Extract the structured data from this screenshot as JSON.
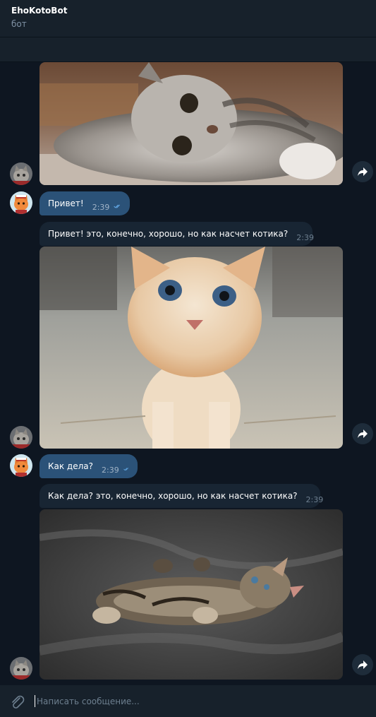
{
  "header": {
    "title": "EhoKotoBot",
    "subtitle": "бот"
  },
  "messages": [
    {
      "type": "photo",
      "from": "bot",
      "alt": "gray tabby kitten lying on a rug"
    },
    {
      "type": "text",
      "from": "user",
      "text": "Привет!",
      "time": "2:39",
      "status": "read"
    },
    {
      "type": "text",
      "from": "bot",
      "text": "Привет! это, конечно, хорошо, но как насчет котика?",
      "time": "2:39"
    },
    {
      "type": "photo",
      "from": "bot",
      "alt": "ginger kitten with blue eyes"
    },
    {
      "type": "text",
      "from": "user",
      "text": "Как дела?",
      "time": "2:39",
      "status": "read"
    },
    {
      "type": "text",
      "from": "bot",
      "text": "Как дела? это, конечно, хорошо, но как насчет котика?",
      "time": "2:39"
    },
    {
      "type": "photo",
      "from": "bot",
      "alt": "tabby kitten lying on its back"
    }
  ],
  "composer": {
    "placeholder": "Написать сообщение..."
  },
  "icons": {
    "forward": "forward-arrow-icon",
    "attach": "paperclip-icon",
    "read": "double-check-icon"
  },
  "colors": {
    "background": "#0e1621",
    "panel": "#17212b",
    "outgoing_bubble": "#2b5278",
    "incoming_bubble": "#182533",
    "check": "#6ab3f3"
  }
}
